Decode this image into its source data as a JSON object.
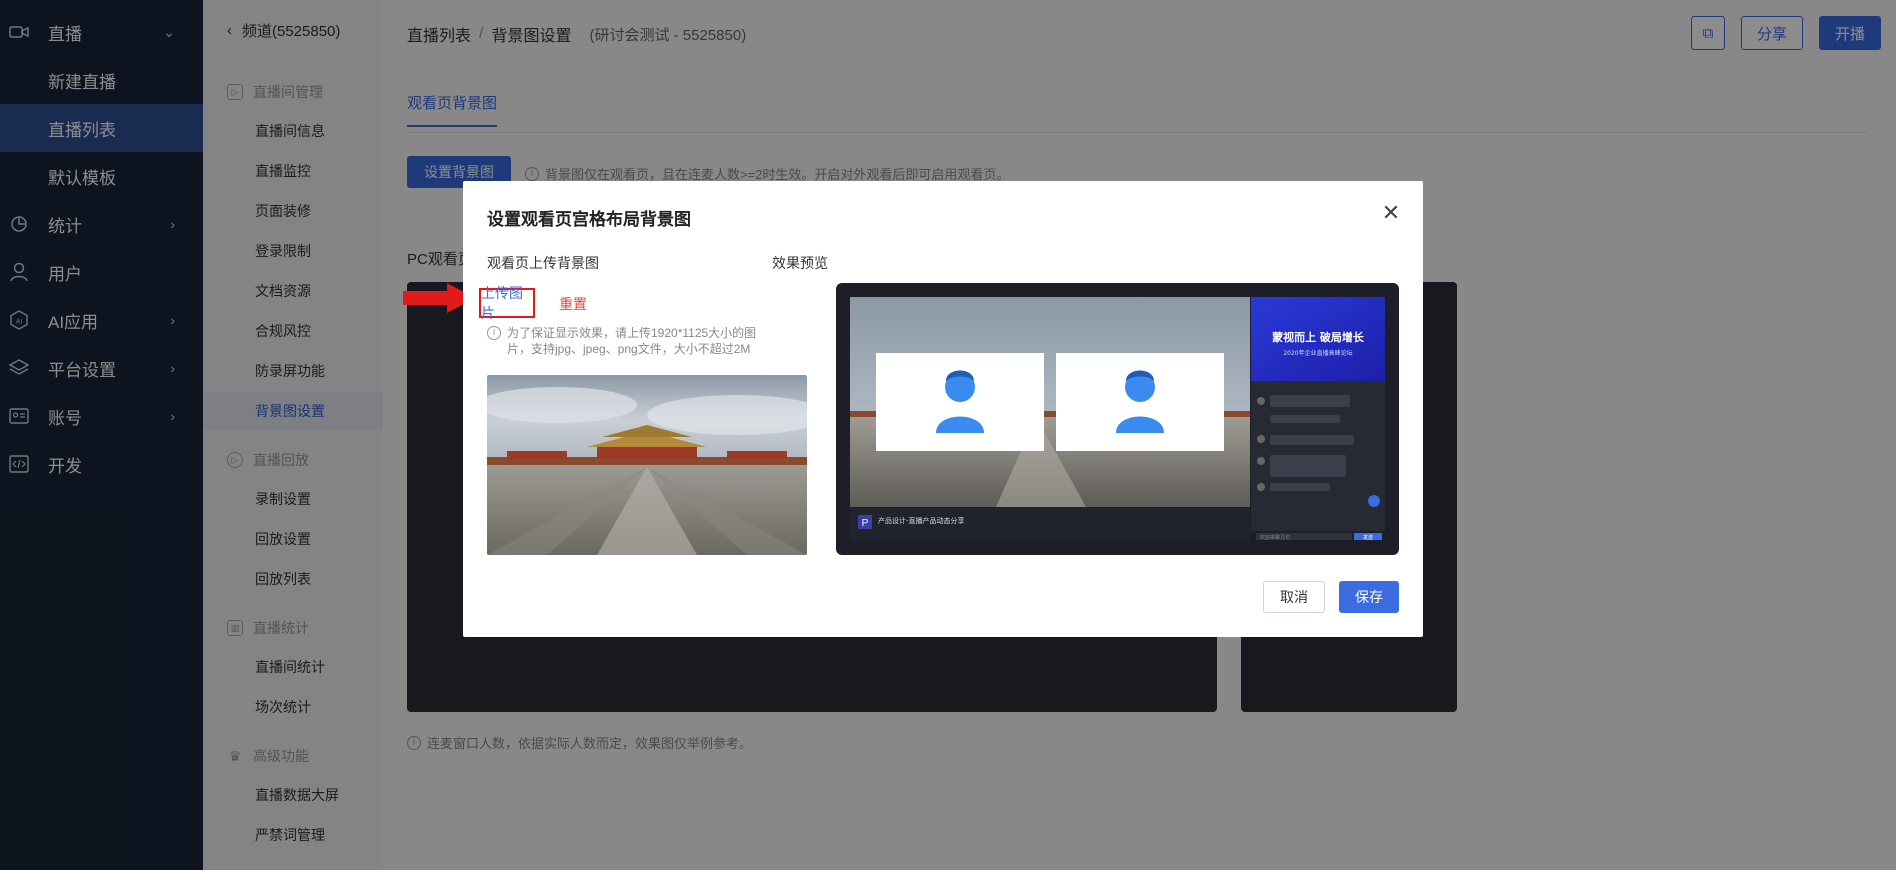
{
  "sidebar": {
    "items": [
      {
        "label": "直播",
        "icon": "camera-icon"
      },
      {
        "label": "新建直播"
      },
      {
        "label": "直播列表"
      },
      {
        "label": "默认模板"
      },
      {
        "label": "统计",
        "icon": "pie-chart-icon"
      },
      {
        "label": "用户",
        "icon": "user-icon"
      },
      {
        "label": "AI应用",
        "icon": "ai-icon"
      },
      {
        "label": "平台设置",
        "icon": "layers-icon"
      },
      {
        "label": "账号",
        "icon": "id-card-icon"
      },
      {
        "label": "开发",
        "icon": "code-icon"
      }
    ]
  },
  "subnav": {
    "back": "频道(5525850)",
    "groups": [
      {
        "label": "直播间管理",
        "items": [
          "直播间信息",
          "直播监控",
          "页面装修",
          "登录限制",
          "文档资源",
          "合规风控",
          "防录屏功能",
          "背景图设置"
        ]
      },
      {
        "label": "直播回放",
        "items": [
          "录制设置",
          "回放设置",
          "回放列表"
        ]
      },
      {
        "label": "直播统计",
        "items": [
          "直播间统计",
          "场次统计"
        ]
      },
      {
        "label": "高级功能",
        "items": [
          "直播数据大屏",
          "严禁词管理"
        ]
      }
    ]
  },
  "header": {
    "crumb1": "直播列表",
    "sep": "/",
    "crumb2": "背景图设置",
    "sub": "(研讨会测试 - 5525850)",
    "share": "分享",
    "start": "开播"
  },
  "page": {
    "tab": "观看页背景图",
    "set_button": "设置背景图",
    "hint": "背景图仅在观看页，且在连麦人数>=2时生效。开启对外观看后即可启用观看页。",
    "pc_label": "PC观看页",
    "bottom_hint": "连麦窗口人数，依据实际人数而定，效果图仅举例参考。"
  },
  "modal": {
    "title": "设置观看页宫格布局背景图",
    "close": "✕",
    "upload_label": "观看页上传背景图",
    "upload_link": "上传图片",
    "reset_link": "重置",
    "hint": "为了保证显示效果，请上传1920*1125大小的图片，支持jpg、jpeg、png文件，大小不超过2M",
    "preview_label": "效果预览",
    "cancel": "取消",
    "save": "保存",
    "preview": {
      "title": "产品设计-直播产品动态分享",
      "sub": "蒙视而上 破局增长",
      "sub2": "2020年企业直播高峰论坛",
      "footer": "欢迎来聊几句",
      "send": "发送"
    }
  },
  "colors": {
    "primary": "#3a6be0",
    "sidebar": "#1b2639",
    "highlight": "#e11a1a"
  }
}
